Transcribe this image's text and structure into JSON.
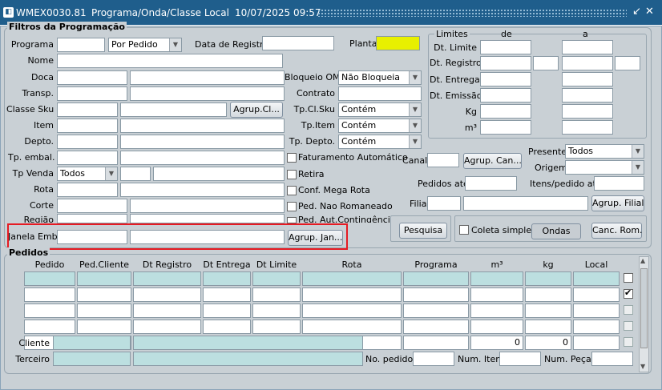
{
  "window": {
    "code": "WMEX0030.81",
    "title": "Programa/Onda/Classe Local",
    "datetime": "10/07/2025 09:57",
    "controls": [
      "↙",
      "✕"
    ]
  },
  "filters": {
    "title": "Filtros da Programação",
    "programa": {
      "label": "Programa",
      "value": "",
      "select": "Por Pedido"
    },
    "data_registro": {
      "label": "Data de Registro",
      "value": ""
    },
    "planta": {
      "label": "Planta",
      "value": ""
    },
    "nome": {
      "label": "Nome"
    },
    "doca": {
      "label": "Doca"
    },
    "transp": {
      "label": "Transp."
    },
    "classe_sku": {
      "label": "Classe Sku",
      "button": "Agrup.Cl..."
    },
    "item": {
      "label": "Item"
    },
    "depto": {
      "label": "Depto."
    },
    "tp_embal": {
      "label": "Tp. embal."
    },
    "tp_venda": {
      "label": "Tp Venda",
      "select": "Todos"
    },
    "rota": {
      "label": "Rota"
    },
    "corte": {
      "label": "Corte"
    },
    "regiao": {
      "label": "Região"
    },
    "janela_emb": {
      "label": "Janela Emb",
      "button": "Agrup. Jan..."
    },
    "bloqueio_om": {
      "label": "Bloqueio OM",
      "select": "Não Bloqueia"
    },
    "contrato": {
      "label": "Contrato"
    },
    "tp_cl_sku": {
      "label": "Tp.Cl.Sku",
      "select": "Contém"
    },
    "tp_item": {
      "label": "Tp.Item",
      "select": "Contém"
    },
    "tp_depto": {
      "label": "Tp. Depto.",
      "select": "Contém"
    },
    "checks": [
      {
        "label": "Faturamento Automático",
        "checked": false
      },
      {
        "label": "Retira",
        "checked": false
      },
      {
        "label": "Conf. Mega Rota",
        "checked": false
      },
      {
        "label": "Ped. Nao Romaneado",
        "checked": false
      },
      {
        "label": "Ped. Aut.Contingência",
        "checked": false
      }
    ],
    "limites": {
      "title": "Limites",
      "col_de": "de",
      "col_a": "a",
      "rows": [
        "Dt. Limite",
        "Dt. Registro",
        "Dt. Entrega",
        "Dt. Emissão",
        "Kg",
        "m³"
      ]
    },
    "canal": {
      "label": "Canal",
      "button": "Agrup. Can..."
    },
    "presente": {
      "label": "Presente",
      "select": "Todos"
    },
    "origem": {
      "label": "Origem",
      "select": ""
    },
    "pedidos_ate": {
      "label": "Pedidos até"
    },
    "itens_pedido_ate": {
      "label": "Itens/pedido até"
    },
    "filial": {
      "label": "Filial",
      "button": "Agrup. Filial"
    },
    "pesquisa_button": "Pesquisa",
    "coleta_simples": {
      "label": "Coleta simples",
      "checked": false
    },
    "ondas_button": "Ondas",
    "canc_rom_button": "Canc. Rom."
  },
  "pedidos": {
    "title": "Pedidos",
    "columns": [
      "Pedido",
      "Ped.Cliente",
      "Dt Registro",
      "Dt Entrega",
      "Dt Limite",
      "Rota",
      "Programa",
      "m³",
      "kg",
      "Local"
    ],
    "row_checks": [
      false,
      true,
      false,
      false,
      false
    ],
    "cliente_label": "Cliente",
    "terceiro_label": "Terceiro",
    "m3_total": "0",
    "kg_total": "0",
    "no_pedidos_label": "No. pedidos",
    "num_itens_label": "Num. Itens",
    "num_pecas_label": "Num. Peças"
  }
}
